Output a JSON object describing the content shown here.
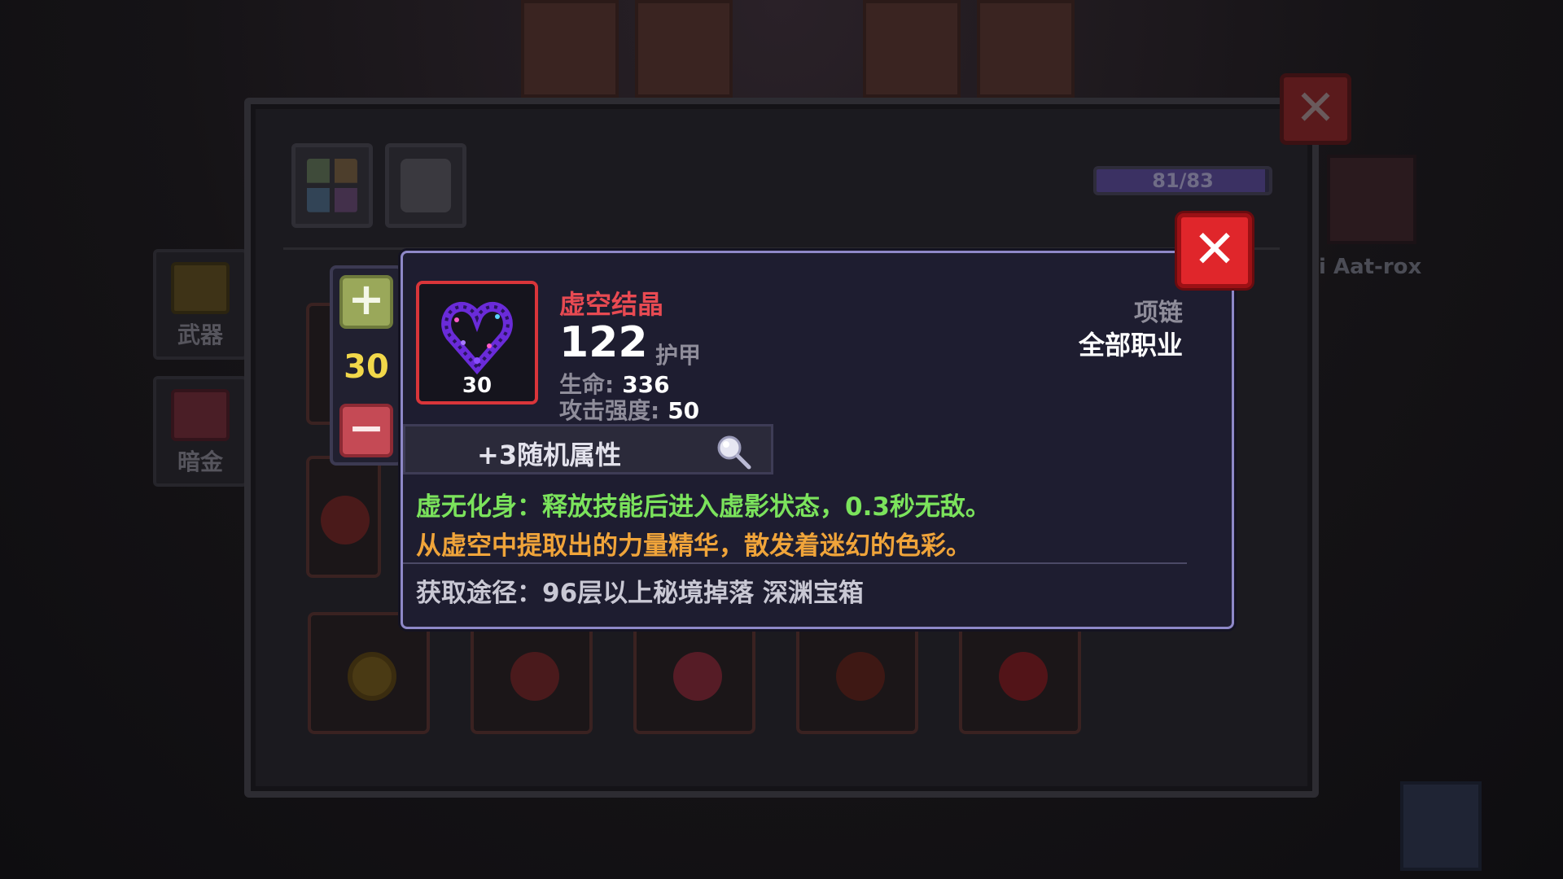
{
  "background": {
    "npc_name": "i Aat-rox"
  },
  "side_tabs": [
    {
      "label": "武器",
      "icon": "weapon-icon"
    },
    {
      "label": "暗金",
      "icon": "darkgold-icon"
    }
  ],
  "panel": {
    "progress": {
      "text": "81/83",
      "current": 81,
      "max": 83
    },
    "close_label": "✕",
    "top_icons": [
      "inventory-icon",
      "character-icon"
    ]
  },
  "stepper": {
    "plus_label": "+",
    "value": "30",
    "minus_label": "−"
  },
  "tooltip": {
    "item_name": "虚空结晶",
    "item_level": "30",
    "armor_value": "122",
    "armor_label": "护甲",
    "stats": [
      {
        "key": "生命:",
        "value": "336"
      },
      {
        "key": "攻击强度:",
        "value": "50"
      }
    ],
    "item_type": "项链",
    "item_class": "全部职业",
    "random_attr_label": "+3随机属性",
    "effect_text": "虚无化身：释放技能后进入虚影状态，0.3秒无敌。",
    "flavor_text": "从虚空中提取出的力量精华，散发着迷幻的色彩。",
    "source_text": "获取途径：96层以上秘境掉落 深渊宝箱",
    "close_label": "✕"
  },
  "colors": {
    "item_name": "#e84a52",
    "effect": "#7be35c",
    "flavor": "#f0a43a",
    "stepper_value": "#f2d84a",
    "close_button": "#e0262b"
  }
}
